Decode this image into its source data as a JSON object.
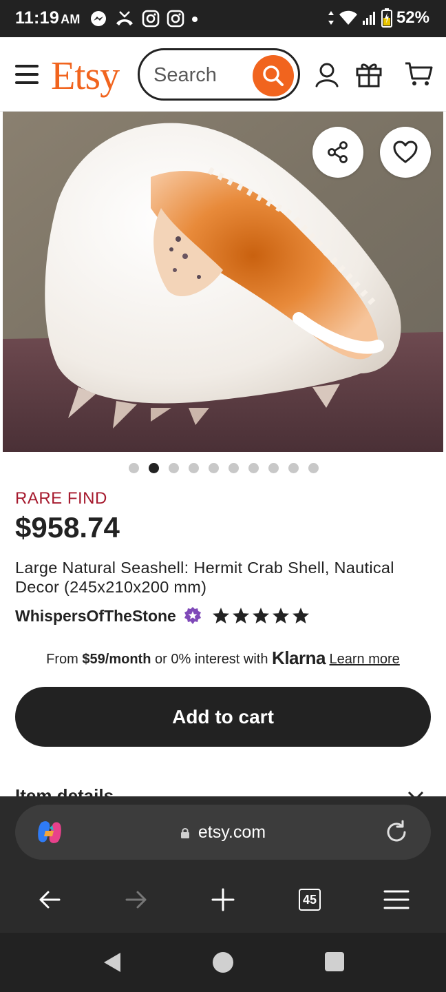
{
  "status_bar": {
    "time": "11:19",
    "ampm": "AM",
    "battery": "52%",
    "icons": [
      "messenger-icon",
      "missed-call-icon",
      "instagram-icon",
      "instagram-icon",
      "dot-icon",
      "data-arrows-icon",
      "wifi-icon",
      "signal-icon",
      "battery-icon"
    ]
  },
  "header": {
    "logo": "Etsy",
    "search_placeholder": "Search",
    "brand_color": "#F1641E",
    "icons": [
      "menu-icon",
      "search-icon",
      "account-icon",
      "gift-icon",
      "cart-icon"
    ]
  },
  "product_image": {
    "subject": "large white and orange seashell",
    "buttons": [
      "share-icon",
      "favorite-heart-icon"
    ],
    "carousel": {
      "total": 10,
      "active_index": 1
    }
  },
  "product": {
    "badge": "RARE FIND",
    "price": "$958.74",
    "title": "Large Natural Seashell: Hermit Crab Shell, Nautical Decor (245x210x200 mm)",
    "seller": "WhispersOfTheStone",
    "rating_stars": 5,
    "badge_color": "#A61A2E"
  },
  "financing": {
    "prefix": "From ",
    "monthly": "$59/month",
    "middle": " or 0% interest with ",
    "brand": "Klarna",
    "link": "Learn more"
  },
  "actions": {
    "add_to_cart": "Add to cart"
  },
  "section": {
    "item_details": "Item details"
  },
  "browser": {
    "url": "etsy.com",
    "tab_count": "45",
    "icons": [
      "copilot-icon",
      "lock-icon",
      "reload-icon",
      "back-icon",
      "forward-icon",
      "new-tab-icon",
      "tabs-icon",
      "menu-icon"
    ]
  },
  "system_nav": {
    "icons": [
      "back-triangle-icon",
      "home-circle-icon",
      "recents-square-icon"
    ]
  }
}
